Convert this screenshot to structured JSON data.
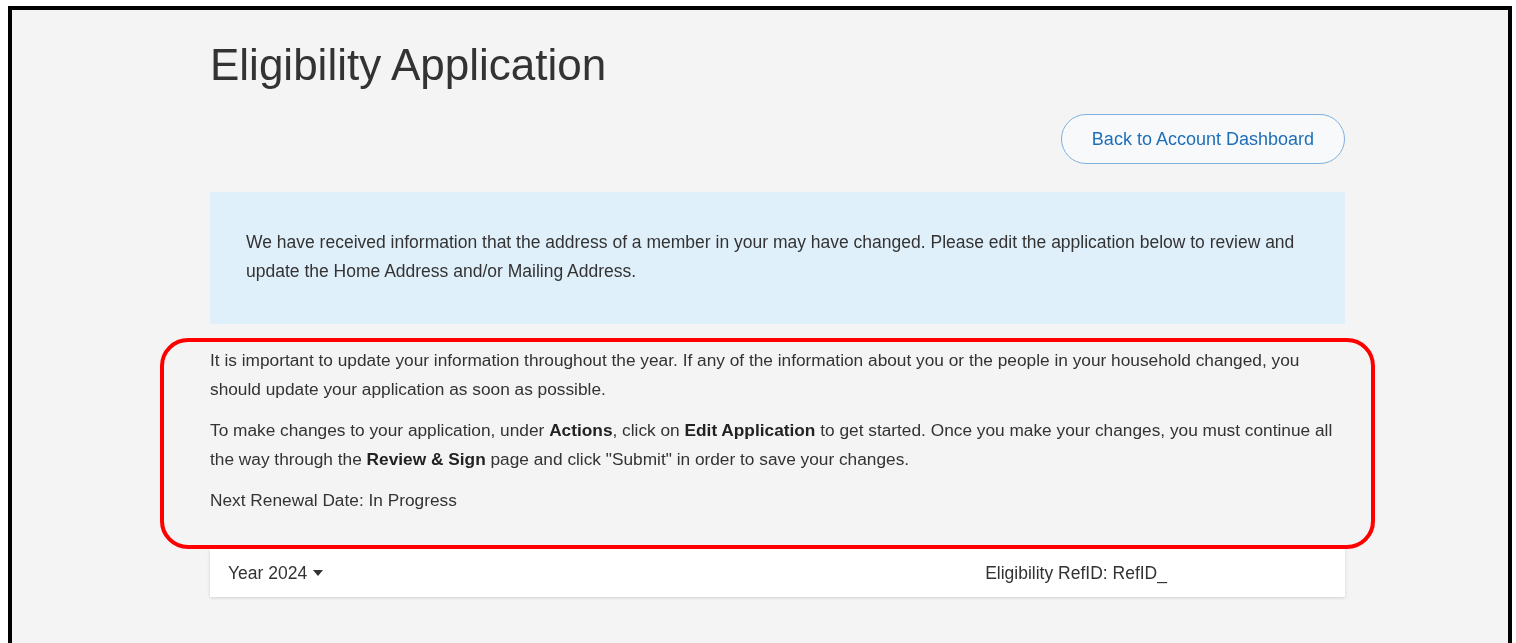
{
  "page_title": "Eligibility Application",
  "back_button": "Back to Account Dashboard",
  "info_banner": "We have received information that the address of a member in your may have changed. Please edit the application below to review and update the Home Address and/or Mailing Address.",
  "notice": {
    "highlighted": true,
    "paragraphs": [
      "It is important to update your information throughout the year. If any of the information about you or the people in your household changed, you should update your application as soon as possible.",
      "To make changes to your application, under **Actions**, click on **Edit Application** to get started. Once you make your changes, you must continue all the way through the **Review & Sign** page and click \"Submit\" in order to save your changes.",
      "Next Renewal Date: In Progress"
    ]
  },
  "year_bar": {
    "year_selector": "Year 2024",
    "ref_id": "Eligibility RefID: RefID_"
  }
}
